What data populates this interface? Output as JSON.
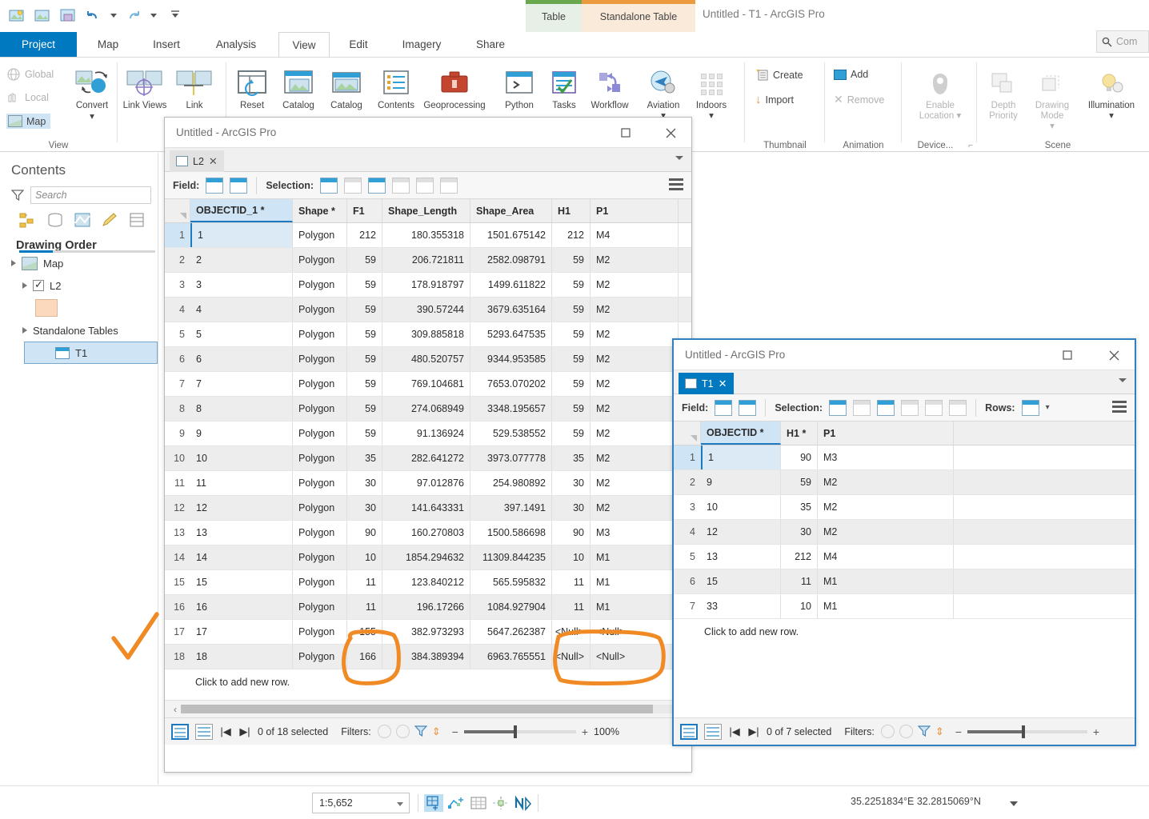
{
  "app": {
    "window_title": "Untitled - T1 - ArcGIS Pro",
    "quick_access": [
      "new-project-icon",
      "open-project-icon",
      "save-project-icon",
      "undo-icon",
      "redo-icon",
      "customize-qat-icon"
    ]
  },
  "contextual_tabs": [
    {
      "label": "Table",
      "group": "View",
      "color": "#6aa84f"
    },
    {
      "label": "Standalone Table",
      "group": "Data",
      "color": "#eb9b3d"
    }
  ],
  "ribbon_tabs": [
    {
      "label": "Project",
      "state": "project"
    },
    {
      "label": "Map",
      "state": "normal"
    },
    {
      "label": "Insert",
      "state": "normal"
    },
    {
      "label": "Analysis",
      "state": "normal"
    },
    {
      "label": "View",
      "state": "active"
    },
    {
      "label": "Edit",
      "state": "normal"
    },
    {
      "label": "Imagery",
      "state": "normal"
    },
    {
      "label": "Share",
      "state": "normal"
    }
  ],
  "search": {
    "placeholder": "Com"
  },
  "ribbon": {
    "groups": [
      {
        "name": "View"
      },
      {
        "name": "Thumbnail"
      },
      {
        "name": "Animation"
      },
      {
        "name": "Device..."
      },
      {
        "name": "Scene"
      }
    ],
    "view_small": [
      {
        "label": "Global",
        "disabled": true
      },
      {
        "label": "Local",
        "disabled": true
      },
      {
        "label": "Map",
        "disabled": false
      }
    ],
    "buttons": [
      {
        "label": "Convert",
        "caret": true
      },
      {
        "label": "Link Views",
        "caret": false
      },
      {
        "label": "Link",
        "caret": false
      },
      {
        "label": "Reset",
        "caret": false
      },
      {
        "label": "Catalog",
        "caret": false
      },
      {
        "label": "Catalog",
        "caret": false
      },
      {
        "label": "Contents",
        "caret": false
      },
      {
        "label": "Geoprocessing",
        "caret": false
      },
      {
        "label": "Python",
        "caret": false
      },
      {
        "label": "Tasks",
        "caret": false
      },
      {
        "label": "Workflow",
        "caret": false
      },
      {
        "label": "Aviation",
        "caret": true
      },
      {
        "label": "Indoors",
        "caret": true
      }
    ],
    "thumbnail": [
      {
        "label": "Create",
        "disabled": false
      },
      {
        "label": "Import",
        "disabled": false
      }
    ],
    "animation": [
      {
        "label": "Add",
        "disabled": false
      },
      {
        "label": "Remove",
        "disabled": true
      }
    ],
    "device": [
      {
        "label": "Enable Location",
        "disabled": true,
        "caret": true
      }
    ],
    "scene": [
      {
        "label": "Depth Priority",
        "disabled": true,
        "caret": false
      },
      {
        "label": "Drawing Mode",
        "disabled": true,
        "caret": true
      },
      {
        "label": "Illumination",
        "disabled": false,
        "caret": true
      }
    ]
  },
  "contents": {
    "title": "Contents",
    "search_placeholder": "Search",
    "tool_icons": [
      "list-by-drawing-order-icon",
      "list-by-data-source-icon",
      "list-by-selection-icon",
      "list-by-editing-icon",
      "list-by-snapping-icon"
    ],
    "heading": "Drawing Order",
    "tree": [
      {
        "label": "Map",
        "kind": "map",
        "indent": 0
      },
      {
        "label": "L2",
        "kind": "layer",
        "indent": 1,
        "checked": true
      },
      {
        "label": "",
        "kind": "symbol",
        "indent": 2
      },
      {
        "label": "Standalone Tables",
        "kind": "folder",
        "indent": 1
      },
      {
        "label": "T1",
        "kind": "table",
        "indent": 2,
        "selected": true
      }
    ]
  },
  "l2_window": {
    "title": "Untitled - ArcGIS Pro",
    "tab_label": "L2",
    "toolbar": {
      "field_label": "Field:",
      "selection_label": "Selection:"
    },
    "columns": [
      "OBJECTID_1 *",
      "Shape *",
      "F1",
      "Shape_Length",
      "Shape_Area",
      "H1",
      "P1"
    ],
    "rows": [
      {
        "n": "1",
        "c": [
          "1",
          "Polygon",
          "212",
          "180.355318",
          "1501.675142",
          "212",
          "M4"
        ]
      },
      {
        "n": "2",
        "c": [
          "2",
          "Polygon",
          "59",
          "206.721811",
          "2582.098791",
          "59",
          "M2"
        ]
      },
      {
        "n": "3",
        "c": [
          "3",
          "Polygon",
          "59",
          "178.918797",
          "1499.611822",
          "59",
          "M2"
        ]
      },
      {
        "n": "4",
        "c": [
          "4",
          "Polygon",
          "59",
          "390.57244",
          "3679.635164",
          "59",
          "M2"
        ]
      },
      {
        "n": "5",
        "c": [
          "5",
          "Polygon",
          "59",
          "309.885818",
          "5293.647535",
          "59",
          "M2"
        ]
      },
      {
        "n": "6",
        "c": [
          "6",
          "Polygon",
          "59",
          "480.520757",
          "9344.953585",
          "59",
          "M2"
        ]
      },
      {
        "n": "7",
        "c": [
          "7",
          "Polygon",
          "59",
          "769.104681",
          "7653.070202",
          "59",
          "M2"
        ]
      },
      {
        "n": "8",
        "c": [
          "8",
          "Polygon",
          "59",
          "274.068949",
          "3348.195657",
          "59",
          "M2"
        ]
      },
      {
        "n": "9",
        "c": [
          "9",
          "Polygon",
          "59",
          "91.136924",
          "529.538552",
          "59",
          "M2"
        ]
      },
      {
        "n": "10",
        "c": [
          "10",
          "Polygon",
          "35",
          "282.641272",
          "3973.077778",
          "35",
          "M2"
        ]
      },
      {
        "n": "11",
        "c": [
          "11",
          "Polygon",
          "30",
          "97.012876",
          "254.980892",
          "30",
          "M2"
        ]
      },
      {
        "n": "12",
        "c": [
          "12",
          "Polygon",
          "30",
          "141.643331",
          "397.1491",
          "30",
          "M2"
        ]
      },
      {
        "n": "13",
        "c": [
          "13",
          "Polygon",
          "90",
          "160.270803",
          "1500.586698",
          "90",
          "M3"
        ]
      },
      {
        "n": "14",
        "c": [
          "14",
          "Polygon",
          "10",
          "1854.294632",
          "11309.844235",
          "10",
          "M1"
        ]
      },
      {
        "n": "15",
        "c": [
          "15",
          "Polygon",
          "11",
          "123.840212",
          "565.595832",
          "11",
          "M1"
        ]
      },
      {
        "n": "16",
        "c": [
          "16",
          "Polygon",
          "11",
          "196.17266",
          "1084.927904",
          "11",
          "M1"
        ]
      },
      {
        "n": "17",
        "c": [
          "17",
          "Polygon",
          "155",
          "382.973293",
          "5647.262387",
          "<Null>",
          "<Null>"
        ]
      },
      {
        "n": "18",
        "c": [
          "18",
          "Polygon",
          "166",
          "384.389394",
          "6963.765551",
          "<Null>",
          "<Null>"
        ]
      }
    ],
    "add_row_label": "Click to add new row.",
    "status": {
      "selected_text": "0 of 18 selected",
      "filters_label": "Filters:",
      "zoom": "100%"
    }
  },
  "t1_window": {
    "title": "Untitled - ArcGIS Pro",
    "tab_label": "T1",
    "toolbar": {
      "field_label": "Field:",
      "selection_label": "Selection:",
      "rows_label": "Rows:"
    },
    "columns": [
      "OBJECTID *",
      "H1 *",
      "P1"
    ],
    "rows": [
      {
        "n": "1",
        "c": [
          "1",
          "90",
          "M3"
        ]
      },
      {
        "n": "2",
        "c": [
          "9",
          "59",
          "M2"
        ]
      },
      {
        "n": "3",
        "c": [
          "10",
          "35",
          "M2"
        ]
      },
      {
        "n": "4",
        "c": [
          "12",
          "30",
          "M2"
        ]
      },
      {
        "n": "5",
        "c": [
          "13",
          "212",
          "M4"
        ]
      },
      {
        "n": "6",
        "c": [
          "15",
          "11",
          "M1"
        ]
      },
      {
        "n": "7",
        "c": [
          "33",
          "10",
          "M1"
        ]
      }
    ],
    "add_row_label": "Click to add new row.",
    "status": {
      "selected_text": "0 of 7 selected",
      "filters_label": "Filters:"
    }
  },
  "status_bar": {
    "scale": "1:5,652",
    "coordinates": "35.2251834°E 32.2815069°N",
    "tools": [
      "select-icon",
      "explore-icon",
      "grid-icon",
      "measure-icon",
      "north-icon"
    ]
  },
  "annotations": {
    "color": "#F08A24",
    "marks": [
      "check-mark",
      "circle-f1-values",
      "circle-null-values"
    ]
  }
}
